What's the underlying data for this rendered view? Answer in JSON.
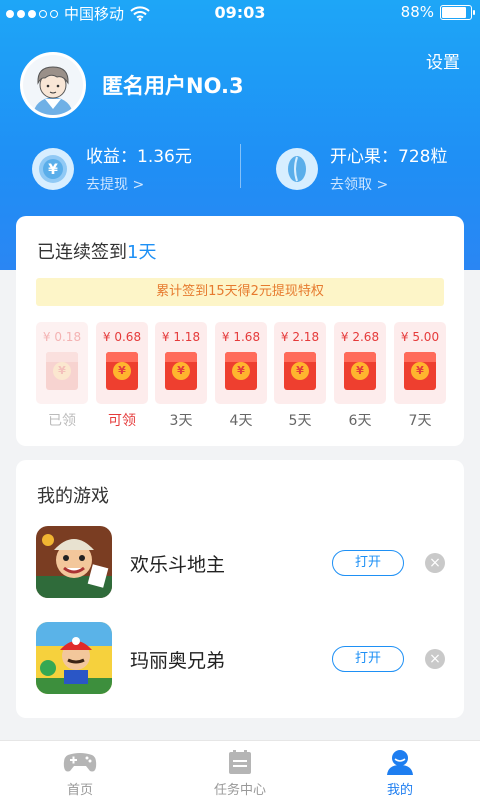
{
  "status_bar": {
    "carrier": "中国移动",
    "time": "09:03",
    "battery": "88%",
    "battery_level": 0.88
  },
  "profile": {
    "settings_label": "设置",
    "username": "匿名用户NO.3"
  },
  "stats": {
    "earnings": {
      "title": "收益：1.36元",
      "link": "去提现 >",
      "icon": "yuan-coin-icon"
    },
    "points": {
      "title": "开心果：728粒",
      "link": "去领取 >",
      "icon": "pistachio-icon"
    }
  },
  "checkin": {
    "title_prefix": "已连续签到",
    "days_count": "1天",
    "banner": "累计签到15天得2元提现特权",
    "days": [
      {
        "amount": "¥ 0.18",
        "label": "已领",
        "state": "done"
      },
      {
        "amount": "¥ 0.68",
        "label": "可领",
        "state": "claim"
      },
      {
        "amount": "¥ 1.18",
        "label": "3天",
        "state": "pending"
      },
      {
        "amount": "¥ 1.68",
        "label": "4天",
        "state": "pending"
      },
      {
        "amount": "¥ 2.18",
        "label": "5天",
        "state": "pending"
      },
      {
        "amount": "¥ 2.68",
        "label": "6天",
        "state": "pending"
      },
      {
        "amount": "¥ 5.00",
        "label": "7天",
        "state": "pending"
      }
    ],
    "coin_symbol": "¥"
  },
  "games": {
    "title": "我的游戏",
    "items": [
      {
        "name": "欢乐斗地主",
        "open_label": "打开"
      },
      {
        "name": "玛丽奥兄弟",
        "open_label": "打开"
      }
    ]
  },
  "tabbar": {
    "items": [
      {
        "label": "首页",
        "icon": "gamepad-icon"
      },
      {
        "label": "任务中心",
        "icon": "calendar-icon"
      },
      {
        "label": "我的",
        "icon": "user-icon",
        "active": true
      }
    ]
  },
  "colors": {
    "header_top": "#1ea6f7",
    "header_bottom": "#2a86f3",
    "accent": "#1e90f5",
    "red": "#e53b3b",
    "banner_bg": "#fdf5c8",
    "banner_text": "#e67a2e"
  }
}
